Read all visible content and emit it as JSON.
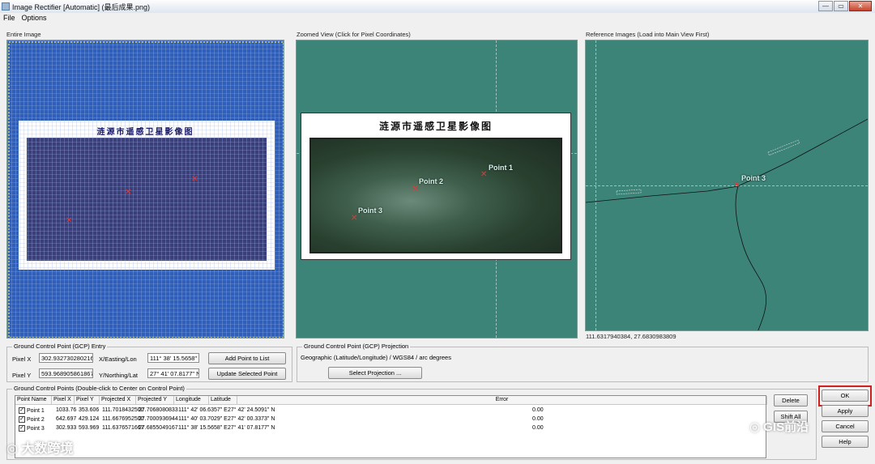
{
  "window": {
    "title": "Image Rectifier [Automatic] (最后成果.png)"
  },
  "menu": {
    "file": "File",
    "options": "Options"
  },
  "panels": {
    "entire": "Entire Image",
    "zoomed": "Zoomed View (Click for Pixel Coordinates)",
    "reference": "Reference Images (Load into Main View First)"
  },
  "map": {
    "title": "涟源市遥感卫星影像图"
  },
  "points": {
    "p1": "Point 1",
    "p2": "Point 2",
    "p3": "Point 3"
  },
  "reference_coords": "111.6317940384, 27.6830983809",
  "gcp_entry": {
    "title": "Ground Control Point (GCP) Entry",
    "pixel_x_label": "Pixel X",
    "pixel_x_value": "302.932730280216",
    "pixel_y_label": "Pixel Y",
    "pixel_y_value": "593.968905861867",
    "x_label": "X/Easting/Lon",
    "x_value": "111° 38' 15.5658\" E",
    "y_label": "Y/Northing/Lat",
    "y_value": "27° 41' 07.8177\" N",
    "add_button": "Add Point to List",
    "update_button": "Update Selected Point"
  },
  "projection": {
    "title": "Ground Control Point (GCP) Projection",
    "value": "Geographic (Latitude/Longitude) / WGS84 / arc degrees",
    "select_button": "Select Projection ..."
  },
  "gcp_list": {
    "title": "Ground Control Points (Double-click to Center on Control Point)",
    "columns": [
      "Point Name",
      "Pixel X",
      "Pixel Y",
      "Projected X",
      "Projected Y",
      "Longitude",
      "Latitude",
      "Error"
    ],
    "rows": [
      {
        "name": "Point 1",
        "px": "1033.76",
        "py": "353.606",
        "projx": "111.7018432500",
        "projy": "27.7068080833",
        "lon": "111° 42' 06.6357\" E",
        "lat": "27° 42' 24.5091\" N",
        "err": "0.00"
      },
      {
        "name": "Point 2",
        "px": "642.697",
        "py": "429.124",
        "projx": "111.6676952500",
        "projy": "27.7000936944",
        "lon": "111° 40' 03.7029\" E",
        "lat": "27° 42' 00.3373\" N",
        "err": "0.00"
      },
      {
        "name": "Point 3",
        "px": "302.933",
        "py": "593.969",
        "projx": "111.6376571667",
        "projy": "27.6855049167",
        "lon": "111° 38' 15.5658\" E",
        "lat": "27° 41' 07.8177\" N",
        "err": "0.00"
      }
    ]
  },
  "buttons": {
    "delete": "Delete",
    "shift_all": "Shift All",
    "ok": "OK",
    "apply": "Apply",
    "cancel": "Cancel",
    "help": "Help"
  },
  "watermarks": {
    "left": "大数跨境",
    "right": "GIS前沿"
  },
  "colors": {
    "view_bg": "#3c8378",
    "grid": "#1d2fa8",
    "marker": "#e03a3a",
    "ok_highlight": "#d02020"
  }
}
